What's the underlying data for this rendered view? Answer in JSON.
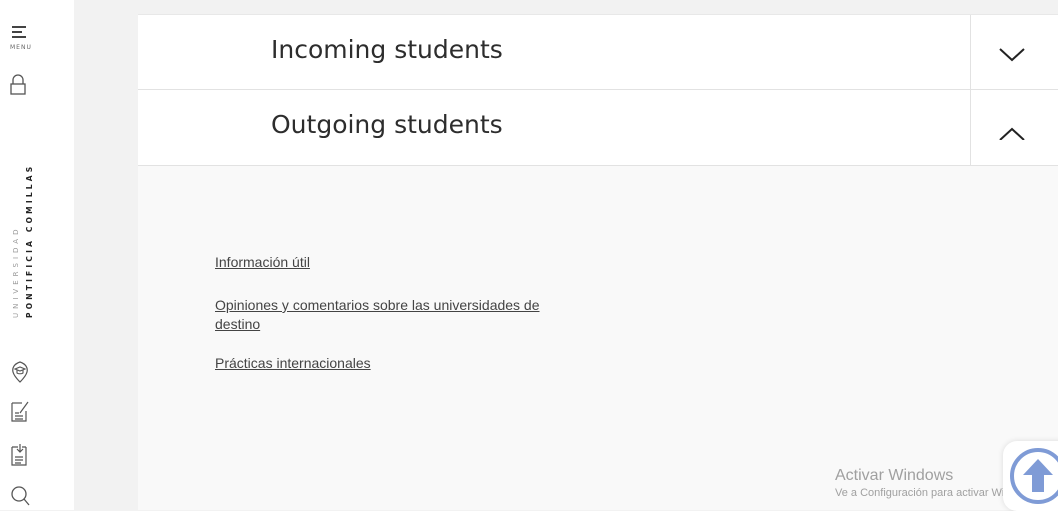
{
  "sidebar": {
    "menu_label": "MENU",
    "brand_line1": "UNIVERSIDAD",
    "brand_line2": "PONTIFICIA COMILLAS",
    "icons": [
      "menu-icon",
      "lock-icon",
      "graduation-cap-icon",
      "edit-form-icon",
      "download-form-icon",
      "search-icon"
    ]
  },
  "accordion": {
    "incoming": {
      "title": "Incoming students",
      "state": "collapsed"
    },
    "outgoing": {
      "title": "Outgoing students",
      "state": "expanded"
    }
  },
  "links": [
    "Información útil",
    "Opiniones y comentarios sobre las universidades de destino",
    "Prácticas internacionales"
  ],
  "watermark": {
    "title": "Activar Windows",
    "subtitle": "Ve a Configuración para activar Windows."
  },
  "colors": {
    "accent": "#7f9bd6",
    "text": "#2d2d2d",
    "link": "#444444"
  }
}
